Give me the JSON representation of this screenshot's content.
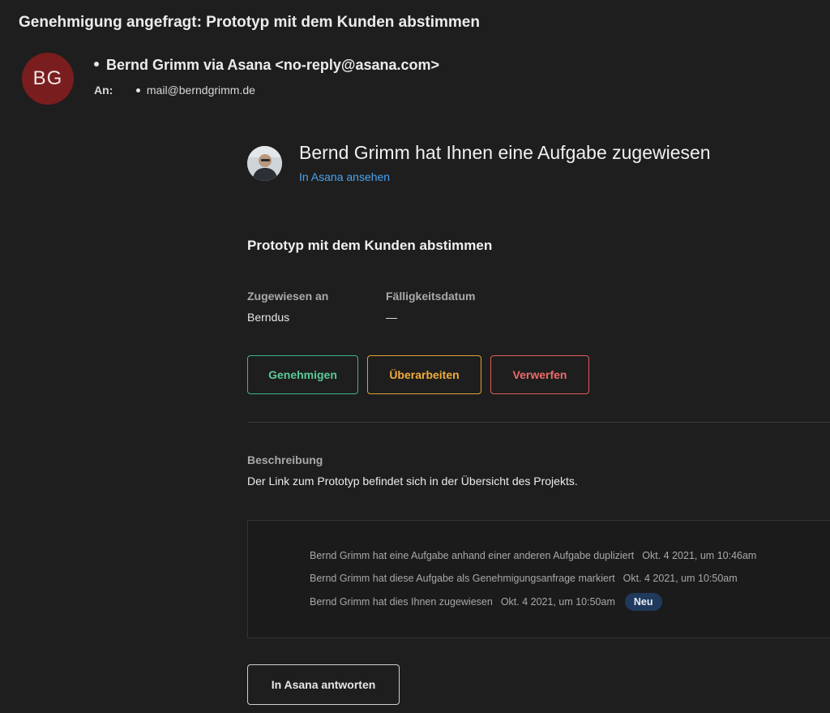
{
  "email": {
    "subject": "Genehmigung angefragt: Prototyp mit dem Kunden abstimmen",
    "sender_initials": "BG",
    "sender": "Bernd Grimm via Asana <no-reply@asana.com>",
    "to_label": "An:",
    "to_address": "mail@berndgrimm.de",
    "avatar_color": "#7a1d1e"
  },
  "asana": {
    "headline": "Bernd Grimm hat Ihnen eine Aufgabe zugewiesen",
    "view_link": "In Asana ansehen",
    "task_title": "Prototyp mit dem Kunden abstimmen",
    "assigned_label": "Zugewiesen an",
    "assigned_value": "Berndus",
    "due_label": "Fälligkeitsdatum",
    "due_value": "—",
    "actions": {
      "approve": "Genehmigen",
      "rework": "Überarbeiten",
      "reject": "Verwerfen"
    },
    "action_colors": {
      "approve": "#5cc99a",
      "rework": "#f0ad3a",
      "reject": "#ef6b6b"
    },
    "description_label": "Beschreibung",
    "description": "Der Link zum Prototyp befindet sich in der Übersicht des Projekts.",
    "activity": [
      {
        "text": "Bernd Grimm hat eine Aufgabe anhand einer anderen Aufgabe dupliziert",
        "timestamp": "Okt. 4 2021, um 10:46am"
      },
      {
        "text": "Bernd Grimm hat diese Aufgabe als Genehmigungsanfrage markiert",
        "timestamp": "Okt. 4 2021, um 10:50am"
      },
      {
        "text": "Bernd Grimm hat dies Ihnen zugewiesen",
        "timestamp": "Okt. 4 2021, um 10:50am",
        "badge": "Neu"
      }
    ],
    "reply_button": "In Asana antworten",
    "link_color": "#4aa3f0"
  }
}
